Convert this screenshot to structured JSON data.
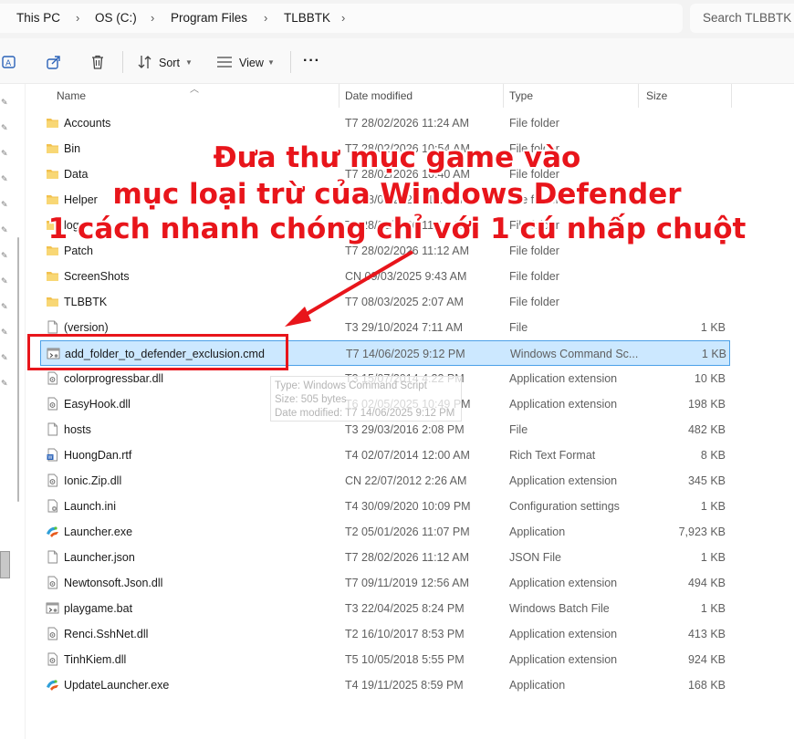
{
  "breadcrumb": [
    "This PC",
    "OS (C:)",
    "Program Files",
    "TLBBTK"
  ],
  "search": {
    "placeholder": "Search TLBBTK"
  },
  "toolbar": {
    "sort_label": "Sort",
    "view_label": "View",
    "more_label": "···"
  },
  "columns": {
    "name": "Name",
    "date": "Date modified",
    "type": "Type",
    "size": "Size"
  },
  "files": [
    {
      "name": "Accounts",
      "date": "T7 28/02/2026 11:24 AM",
      "type": "File folder",
      "size": "",
      "icon": "folder-icon"
    },
    {
      "name": "Bin",
      "date": "T7 28/02/2026 10:54 AM",
      "type": "File folder",
      "size": "",
      "icon": "folder-icon"
    },
    {
      "name": "Data",
      "date": "T7 28/02/2026 10:40 AM",
      "type": "File folder",
      "size": "",
      "icon": "folder-icon"
    },
    {
      "name": "Helper",
      "date": "T7 28/02/2026 11:12 AM",
      "type": "File folder",
      "size": "",
      "icon": "folder-icon"
    },
    {
      "name": "log",
      "date": "T7 28/02/2026 11:12 AM",
      "type": "File folder",
      "size": "",
      "icon": "folder-icon"
    },
    {
      "name": "Patch",
      "date": "T7 28/02/2026 11:12 AM",
      "type": "File folder",
      "size": "",
      "icon": "folder-icon"
    },
    {
      "name": "ScreenShots",
      "date": "CN 09/03/2025 9:43 AM",
      "type": "File folder",
      "size": "",
      "icon": "folder-icon"
    },
    {
      "name": "TLBBTK",
      "date": "T7 08/03/2025 2:07 AM",
      "type": "File folder",
      "size": "",
      "icon": "folder-icon"
    },
    {
      "name": "(version)",
      "date": "T3 29/10/2024 7:11 AM",
      "type": "File",
      "size": "1 KB",
      "icon": "file-icon"
    },
    {
      "name": "add_folder_to_defender_exclusion.cmd",
      "date": "T7 14/06/2025 9:12 PM",
      "type": "Windows Command Sc...",
      "size": "1 KB",
      "icon": "cmd-icon",
      "selected": true
    },
    {
      "name": "colorprogressbar.dll",
      "date": "T3 15/07/2014 4:22 PM",
      "type": "Application extension",
      "size": "10 KB",
      "icon": "dll-icon"
    },
    {
      "name": "EasyHook.dll",
      "date": "T6 02/05/2025 10:49 PM",
      "type": "Application extension",
      "size": "198 KB",
      "icon": "dll-icon"
    },
    {
      "name": "hosts",
      "date": "T3 29/03/2016 2:08 PM",
      "type": "File",
      "size": "482 KB",
      "icon": "file-icon"
    },
    {
      "name": "HuongDan.rtf",
      "date": "T4 02/07/2014 12:00 AM",
      "type": "Rich Text Format",
      "size": "8 KB",
      "icon": "rtf-icon"
    },
    {
      "name": "Ionic.Zip.dll",
      "date": "CN 22/07/2012 2:26 AM",
      "type": "Application extension",
      "size": "345 KB",
      "icon": "dll-icon"
    },
    {
      "name": "Launch.ini",
      "date": "T4 30/09/2020 10:09 PM",
      "type": "Configuration settings",
      "size": "1 KB",
      "icon": "ini-icon"
    },
    {
      "name": "Launcher.exe",
      "date": "T2 05/01/2026 11:07 PM",
      "type": "Application",
      "size": "7,923 KB",
      "icon": "exe-icon"
    },
    {
      "name": "Launcher.json",
      "date": "T7 28/02/2026 11:12 AM",
      "type": "JSON File",
      "size": "1 KB",
      "icon": "file-icon"
    },
    {
      "name": "Newtonsoft.Json.dll",
      "date": "T7 09/11/2019 12:56 AM",
      "type": "Application extension",
      "size": "494 KB",
      "icon": "dll-icon"
    },
    {
      "name": "playgame.bat",
      "date": "T3 22/04/2025 8:24 PM",
      "type": "Windows Batch File",
      "size": "1 KB",
      "icon": "cmd-icon"
    },
    {
      "name": "Renci.SshNet.dll",
      "date": "T2 16/10/2017 8:53 PM",
      "type": "Application extension",
      "size": "413 KB",
      "icon": "dll-icon"
    },
    {
      "name": "TinhKiem.dll",
      "date": "T5 10/05/2018 5:55 PM",
      "type": "Application extension",
      "size": "924 KB",
      "icon": "dll-icon"
    },
    {
      "name": "UpdateLauncher.exe",
      "date": "T4 19/11/2025 8:59 PM",
      "type": "Application",
      "size": "168 KB",
      "icon": "exe-icon"
    }
  ],
  "tooltip": {
    "type_line": "Type: Windows Command Script",
    "size_line": "Size: 505 bytes",
    "date_line": "Date modified: T7 14/06/2025 9:12 PM"
  },
  "annotation": {
    "line1": "Đưa thư mục game vào",
    "line2": "mục loại trừ của Windows Defender",
    "line3": "1 cách nhanh chóng chỉ với 1 cú nhấp chuột",
    "color": "#e8151b"
  },
  "colors": {
    "selection": "#cce8ff",
    "selection_border": "#4aa0e8",
    "folder": "#f2c14e"
  }
}
